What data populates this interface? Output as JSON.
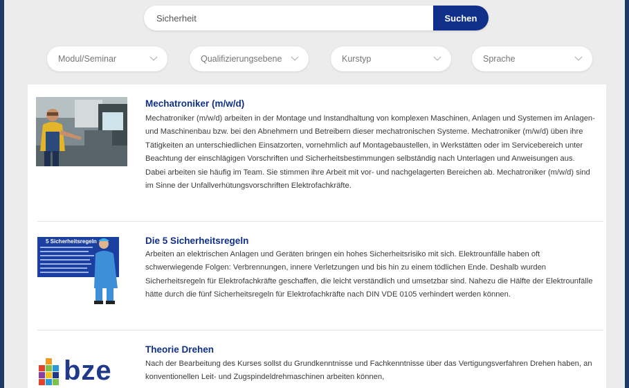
{
  "search": {
    "value": "Sicherheit",
    "button_label": "Suchen"
  },
  "filters": [
    {
      "label": "Modul/Seminar"
    },
    {
      "label": "Qualifizierungsebene"
    },
    {
      "label": "Kurstyp"
    },
    {
      "label": "Sprache"
    }
  ],
  "results": [
    {
      "title": "Mechatroniker (m/w/d)",
      "description": "Mechatroniker (m/w/d) arbeiten in der Montage und Instandhaltung von komplexen Maschinen, Anlagen und Systemen im Anlagen- und Maschinenbau bzw. bei den Abnehmern und Betreibern dieser mechatronischen Systeme. Mechatroniker (m/w/d) üben ihre Tätigkeiten an unterschiedlichen Einsatzorten, vornehmlich auf Montagebaustellen, in Werkstätten oder im Servicebereich unter Beachtung der einschlägigen Vorschriften und Sicherheitsbestimmungen selbständig nach Unterlagen und Anweisungen aus. Dabei arbeiten sie häufig im Team. Sie stimmen ihre Arbeit mit vor- und nachgelagerten Bereichen ab. Mechatroniker (m/w/d) sind im Sinne der Unfallverhütungsvorschriften Elektrofachkräfte."
    },
    {
      "title": "Die 5 Sicherheitsregeln",
      "description": "Arbeiten an elektrischen Anlagen und Geräten bringen ein hohes Sicherheitsrisiko mit sich. Elektrounfälle haben oft schwerwiegende Folgen: Verbrennungen, innere Verletzungen und bis hin zu einem tödlichen Ende. Deshalb wurden Sicherheitsregeln für Elektrofachkräfte geschaffen, die leicht verständlich und umsetzbar sind. Nahezu die Hälfte der Elektrounfälle hätte durch die fünf Sicherheitsregeln für Elektrofachkräfte nach DIN VDE 0105 verhindert werden können.",
      "thumb_heading": "5 Sicherheitsregeln"
    },
    {
      "title": "Theorie Drehen",
      "description": "Nach der Bearbeitung des Kurses sollst du Grundkenntnisse und Fachkenntnisse über das Vertigungsverfahren Drehen haben, an konventionellen Leit- und Zugspindeldrehmaschinen arbeiten können,",
      "logo_text": "bze"
    }
  ],
  "colors": {
    "accent": "#0f2f8a",
    "frame_border": "#1f3a64",
    "page_bg": "#ececec"
  }
}
